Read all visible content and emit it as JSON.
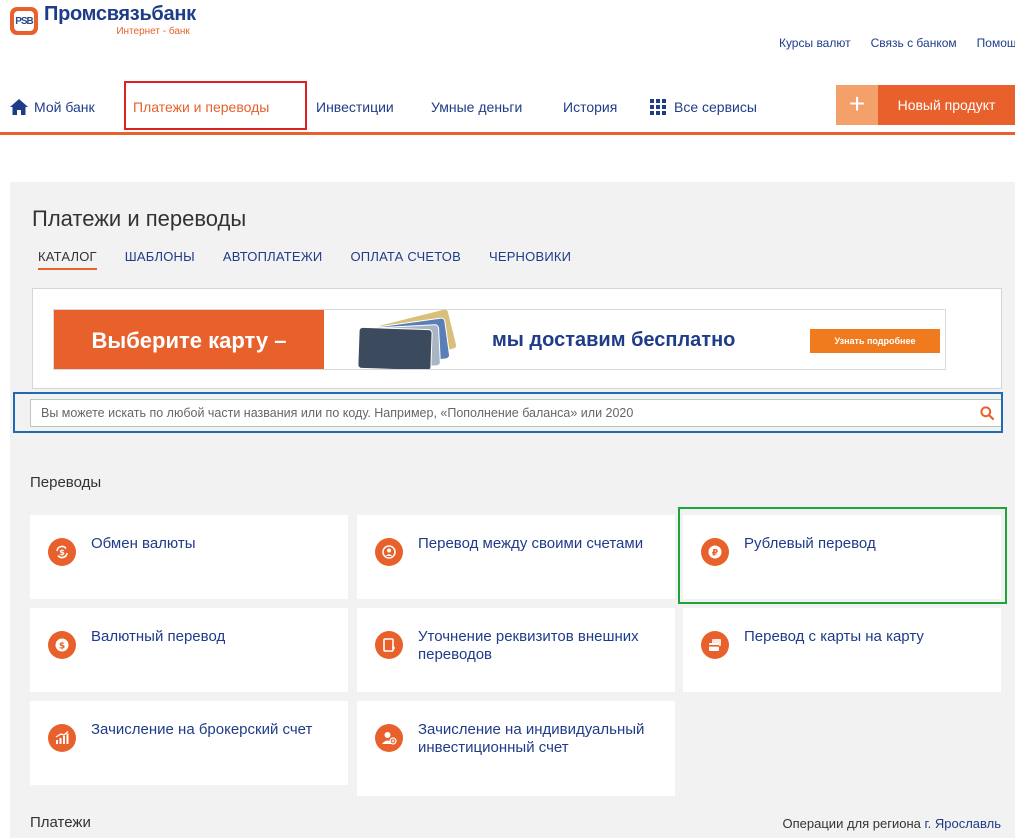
{
  "header": {
    "logo_mark": "PSB",
    "logo_name": "Промсвязьбанк",
    "logo_sub": "Интернет - банк",
    "top_links": [
      "Курсы валют",
      "Связь с банком",
      "Помощь"
    ]
  },
  "nav": {
    "items": [
      {
        "label": "Мой банк",
        "icon": "home-icon"
      },
      {
        "label": "Платежи и переводы",
        "active": true
      },
      {
        "label": "Инвестиции"
      },
      {
        "label": "Умные деньги"
      },
      {
        "label": "История"
      },
      {
        "label": "Все сервисы",
        "icon": "grid-icon"
      }
    ],
    "new_product_plus": "+",
    "new_product_label": "Новый продукт"
  },
  "main": {
    "title": "Платежи и переводы",
    "tabs": [
      {
        "label": "КАТАЛОГ",
        "active": true
      },
      {
        "label": "ШАБЛОНЫ"
      },
      {
        "label": "АВТОПЛАТЕЖИ"
      },
      {
        "label": "ОПЛАТА СЧЕТОВ"
      },
      {
        "label": "ЧЕРНОВИКИ"
      }
    ],
    "banner": {
      "left_text": "Выберите карту –",
      "mid_text": "мы доставим бесплатно",
      "button_text": "Узнать подробнее"
    },
    "search": {
      "placeholder": "Вы можете искать по любой части названия или по коду. Например, «Пополнение баланса» или 2020",
      "value": ""
    },
    "section_transfers": "Переводы",
    "tiles": [
      {
        "label": "Обмен валюты",
        "icon": "currency-exchange-icon"
      },
      {
        "label": "Перевод между своими счетами",
        "icon": "own-accounts-transfer-icon"
      },
      {
        "label": "Рублевый перевод",
        "icon": "ruble-icon"
      },
      {
        "label": "Валютный перевод",
        "icon": "dollar-icon"
      },
      {
        "label": "Уточнение реквизитов внешних переводов",
        "icon": "document-edit-icon"
      },
      {
        "label": "Перевод с карты на карту",
        "icon": "card-to-card-icon"
      },
      {
        "label": "Зачисление на брокерский счет",
        "icon": "chart-growth-icon"
      },
      {
        "label": "Зачисление на индивидуальный инвестиционный счет",
        "icon": "investor-icon"
      }
    ],
    "section_payments": "Платежи",
    "region_prefix": "Операции для региона",
    "region_link": "г. Ярославль"
  },
  "colors": {
    "accent": "#e8612c",
    "link": "#1f3c88",
    "panel_bg": "#f2f2f2",
    "highlight_red": "#e02020",
    "highlight_blue": "#1f6ab3",
    "highlight_green": "#1fa33a"
  }
}
